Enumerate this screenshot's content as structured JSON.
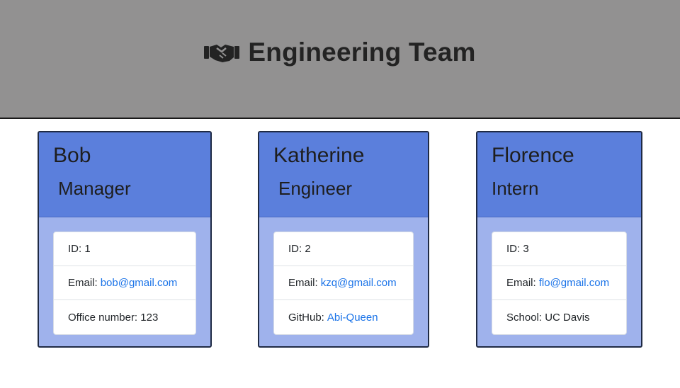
{
  "header": {
    "icon": "handshake-icon",
    "title": "Engineering Team"
  },
  "employees": [
    {
      "name": "Bob",
      "role": "Manager",
      "id_label": "ID:",
      "id": "1",
      "email_label": "Email:",
      "email": "bob@gmail.com",
      "extra_label": "Office number:",
      "extra_value": "123"
    },
    {
      "name": "Katherine",
      "role": "Engineer",
      "id_label": "ID:",
      "id": "2",
      "email_label": "Email:",
      "email": "kzq@gmail.com",
      "extra_label": "GitHub:",
      "extra_value": "Abi-Queen"
    },
    {
      "name": "Florence",
      "role": "Intern",
      "id_label": "ID:",
      "id": "3",
      "email_label": "Email:",
      "email": "flo@gmail.com",
      "extra_label": "School:",
      "extra_value": "UC Davis"
    }
  ],
  "colors": {
    "header_bg": "#929191",
    "card_head": "#5b7fdc",
    "card_body": "#9fb2ec",
    "link": "#1a73e8"
  }
}
